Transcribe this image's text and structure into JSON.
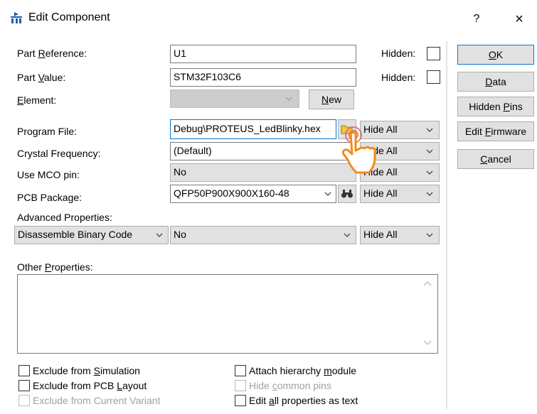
{
  "window": {
    "title": "Edit Component",
    "help": "?",
    "close": "×"
  },
  "fields": {
    "part_reference": {
      "label_pre": "Part ",
      "label_u": "R",
      "label_post": "eference:",
      "value": "U1",
      "hidden_label": "Hidden:"
    },
    "part_value": {
      "label_pre": "Part ",
      "label_u": "V",
      "label_post": "alue:",
      "value": "STM32F103C6",
      "hidden_label": "Hidden:"
    },
    "element": {
      "label_u": "E",
      "label_post": "lement:",
      "value": "",
      "new_pre": "",
      "new_u": "N",
      "new_post": "ew"
    },
    "program_file": {
      "label": "Program File:",
      "value": "Debug\\PROTEUS_LedBlinky.hex",
      "visibility": "Hide All"
    },
    "crystal_frequency": {
      "label": "Crystal Frequency:",
      "value": "(Default)",
      "visibility": "Hide All"
    },
    "use_mco_pin": {
      "label": "Use MCO pin:",
      "value": "No",
      "visibility": "Hide All"
    },
    "pcb_package": {
      "label": "PCB Package:",
      "value": "QFP50P900X900X160-48",
      "visibility": "Hide All"
    },
    "advanced": {
      "label": "Advanced Properties:",
      "property": "Disassemble Binary Code",
      "value": "No",
      "visibility": "Hide All"
    },
    "other_properties": {
      "label_pre": "Other ",
      "label_u": "P",
      "label_post": "roperties:"
    }
  },
  "buttons": {
    "ok": {
      "u": "O",
      "post": "K"
    },
    "data": {
      "u": "D",
      "post": "ata"
    },
    "hidden_pins": {
      "pre": "Hidden ",
      "u": "P",
      "post": "ins"
    },
    "edit_firmware": {
      "pre": "Edit ",
      "u": "F",
      "post": "irmware"
    },
    "cancel": {
      "u": "C",
      "post": "ancel"
    }
  },
  "checkboxes": {
    "exclude_sim": {
      "pre": "Exclude from ",
      "u": "S",
      "post": "imulation"
    },
    "exclude_pcb": {
      "pre": "Exclude from PCB ",
      "u": "L",
      "post": "ayout"
    },
    "exclude_variant": {
      "label": "Exclude from Current Variant"
    },
    "attach_hierarchy": {
      "pre": "Attach hierarchy ",
      "u": "m",
      "post": "odule"
    },
    "hide_common": {
      "pre": "Hide ",
      "u": "c",
      "post": "ommon pins"
    },
    "edit_all": {
      "pre": "Edit ",
      "u": "a",
      "post": "ll properties as text"
    }
  },
  "icons": {
    "title": "component-icon",
    "browse": "folder-icon",
    "pcb_preview": "binoculars-icon",
    "cursor": "hand-pointer-icon"
  }
}
